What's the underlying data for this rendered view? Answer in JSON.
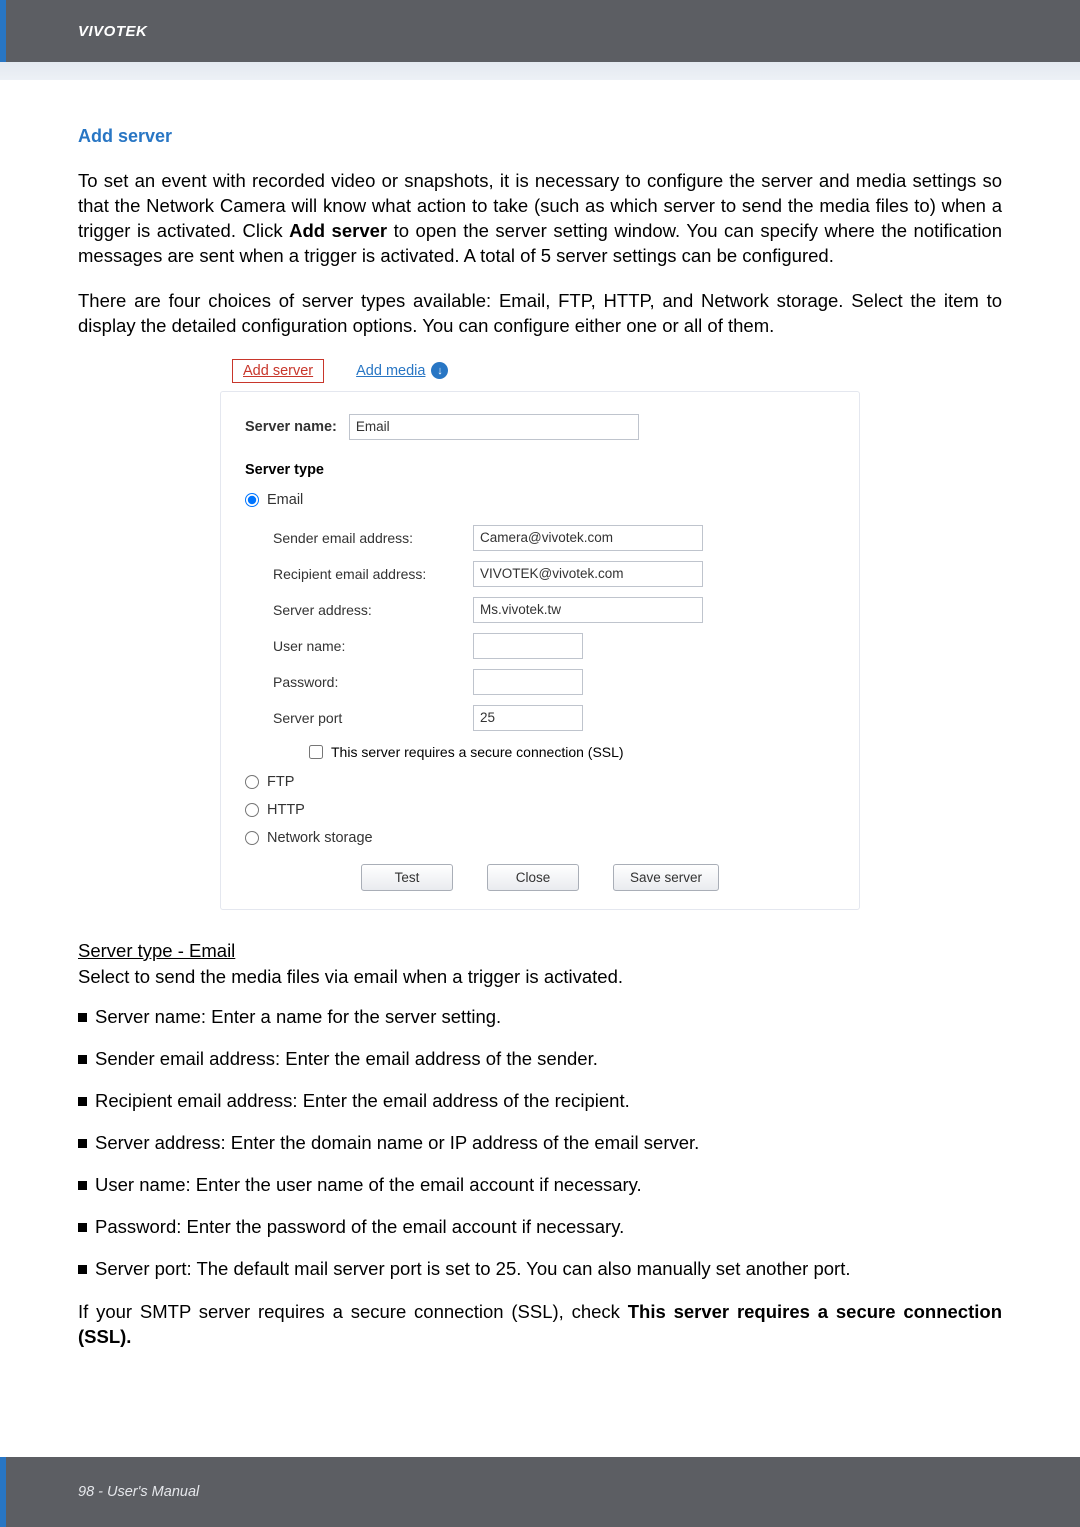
{
  "header": {
    "brand": "VIVOTEK"
  },
  "section": {
    "title": "Add server",
    "intro": "To set an event with recorded video or snapshots, it is necessary to configure the server and media settings so that the Network Camera will know what action to take (such as which server to send the media files to) when a trigger is activated. Click Add server to open the server setting window. You can specify where the notification messages are sent when a trigger is activated. A total of 5 server settings can be configured.",
    "intro2": "There are four choices of server types available: Email, FTP, HTTP, and Network storage. Select the item to display the detailed configuration options. You can configure either one or all of them."
  },
  "panel": {
    "tabs": {
      "add_server": "Add server",
      "add_media": "Add media"
    },
    "server_name_label": "Server name:",
    "server_name_value": "Email",
    "server_type_label": "Server type",
    "email": {
      "radio": "Email",
      "sender_label": "Sender email address:",
      "sender_value": "Camera@vivotek.com",
      "recipient_label": "Recipient email address:",
      "recipient_value": "VIVOTEK@vivotek.com",
      "server_addr_label": "Server address:",
      "server_addr_value": "Ms.vivotek.tw",
      "user_label": "User name:",
      "user_value": "",
      "pass_label": "Password:",
      "pass_value": "",
      "port_label": "Server port",
      "port_value": "25",
      "ssl_label": "This server requires a secure connection (SSL)"
    },
    "ftp_label": "FTP",
    "http_label": "HTTP",
    "netstorage_label": "Network storage",
    "buttons": {
      "test": "Test",
      "close": "Close",
      "save": "Save server"
    }
  },
  "email_section": {
    "heading": "Server type - Email",
    "desc": "Select to send the media files via email when a trigger is activated.",
    "bullets": [
      "Server name: Enter a name for the server setting.",
      "Sender email address: Enter the email address of the sender.",
      "Recipient email address: Enter the email address of the recipient.",
      "Server address: Enter the domain name or IP address of the email server.",
      "User name: Enter the user name of the email account if necessary.",
      "Password: Enter the password of the email account if necessary.",
      "Server port: The default mail server port is set to 25. You can also manually set another port."
    ],
    "closing_a": "If your SMTP server requires a secure connection (SSL), check ",
    "closing_b": "This server requires a secure connection (SSL)."
  },
  "footer": {
    "page": "98 - User's Manual"
  }
}
